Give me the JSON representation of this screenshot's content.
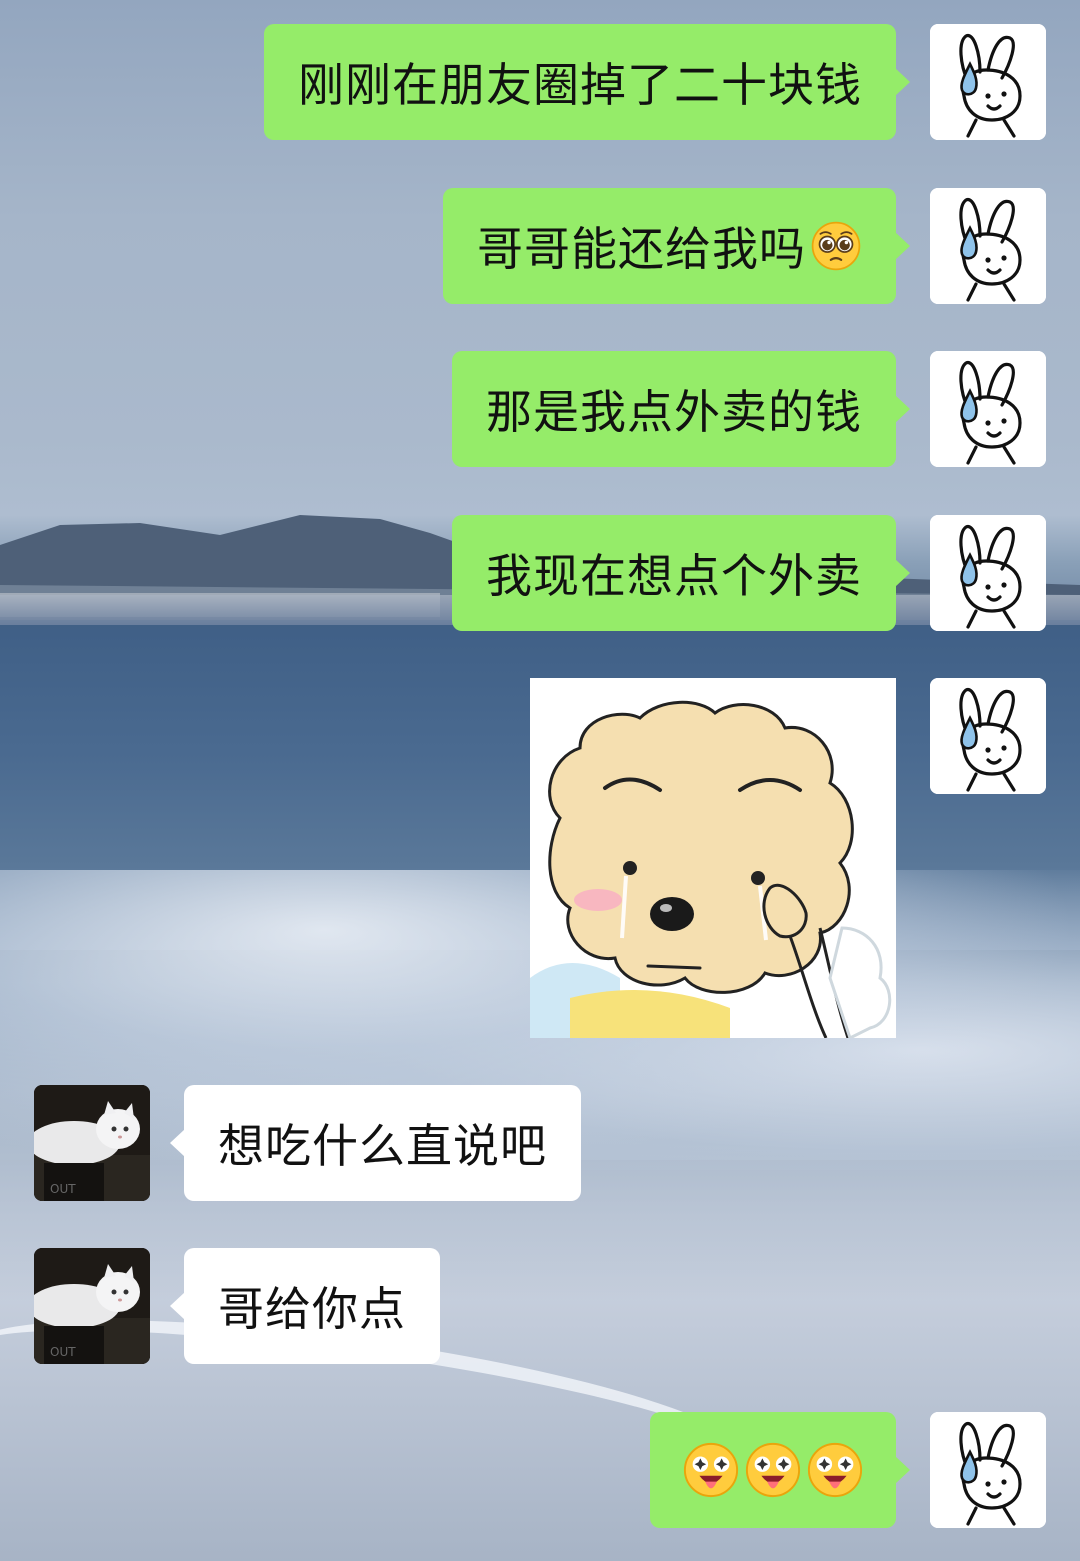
{
  "chat": {
    "messages": [
      {
        "from": "me",
        "text": "刚刚在朋友圈掉了二十块钱"
      },
      {
        "from": "me",
        "text": "哥哥能还给我吗",
        "emoji": "pleading-face"
      },
      {
        "from": "me",
        "text": "那是我点外卖的钱"
      },
      {
        "from": "me",
        "text": "我现在想点个外卖"
      },
      {
        "from": "me",
        "type": "sticker",
        "sticker": "crying-sheep-wiping-tears"
      },
      {
        "from": "friend",
        "text": "想吃什么直说吧"
      },
      {
        "from": "friend",
        "text": "哥给你点"
      },
      {
        "from": "me",
        "type": "emoji-only",
        "emojis": [
          "star-struck-tongue-face",
          "star-struck-tongue-face",
          "star-struck-tongue-face"
        ]
      }
    ],
    "colors": {
      "my_bubble": "#95ec69",
      "friend_bubble": "#ffffff"
    },
    "avatars": {
      "me": "rabbit-sweat-drop-avatar",
      "friend": "white-cat-avatar"
    }
  }
}
